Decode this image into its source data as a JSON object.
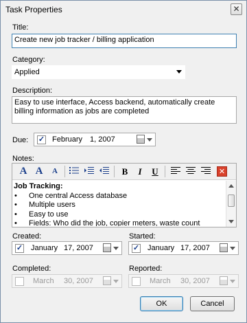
{
  "window": {
    "title": "Task Properties",
    "close_label": "✕"
  },
  "title": {
    "label": "Title:",
    "value": "Create new job tracker / billing application"
  },
  "category": {
    "label": "Category:",
    "value": "Applied"
  },
  "description": {
    "label": "Description:",
    "value": "Easy to use interface, Access backend, automatically create billing information as jobs are completed"
  },
  "due": {
    "label": "Due:",
    "checked": true,
    "month": "February",
    "day": "1, 2007"
  },
  "notes": {
    "label": "Notes:",
    "toolbar": {
      "font_icon": "A",
      "grow_font_icon": "A",
      "shrink_font_icon": "A",
      "bold": "B",
      "italic": "I",
      "underline": "U",
      "clear_icon": "✕"
    },
    "heading": "Job Tracking:",
    "bullets": [
      "One central Access database",
      "Multiple users",
      "Easy to use",
      "Fields: Who did the job, copier meters, waste count"
    ]
  },
  "created": {
    "label": "Created:",
    "checked": true,
    "month": "January",
    "day": "17, 2007"
  },
  "started": {
    "label": "Started:",
    "checked": true,
    "month": "January",
    "day": "17, 2007"
  },
  "completed": {
    "label": "Completed:",
    "checked": false,
    "month": "March",
    "day": "30, 2007"
  },
  "reported": {
    "label": "Reported:",
    "checked": false,
    "month": "March",
    "day": "30, 2007"
  },
  "buttons": {
    "ok": "OK",
    "cancel": "Cancel"
  },
  "colors": {
    "accent": "#3c7fb1",
    "toolbar_icon": "#1b3f8b",
    "clear_red": "#d9412b"
  }
}
